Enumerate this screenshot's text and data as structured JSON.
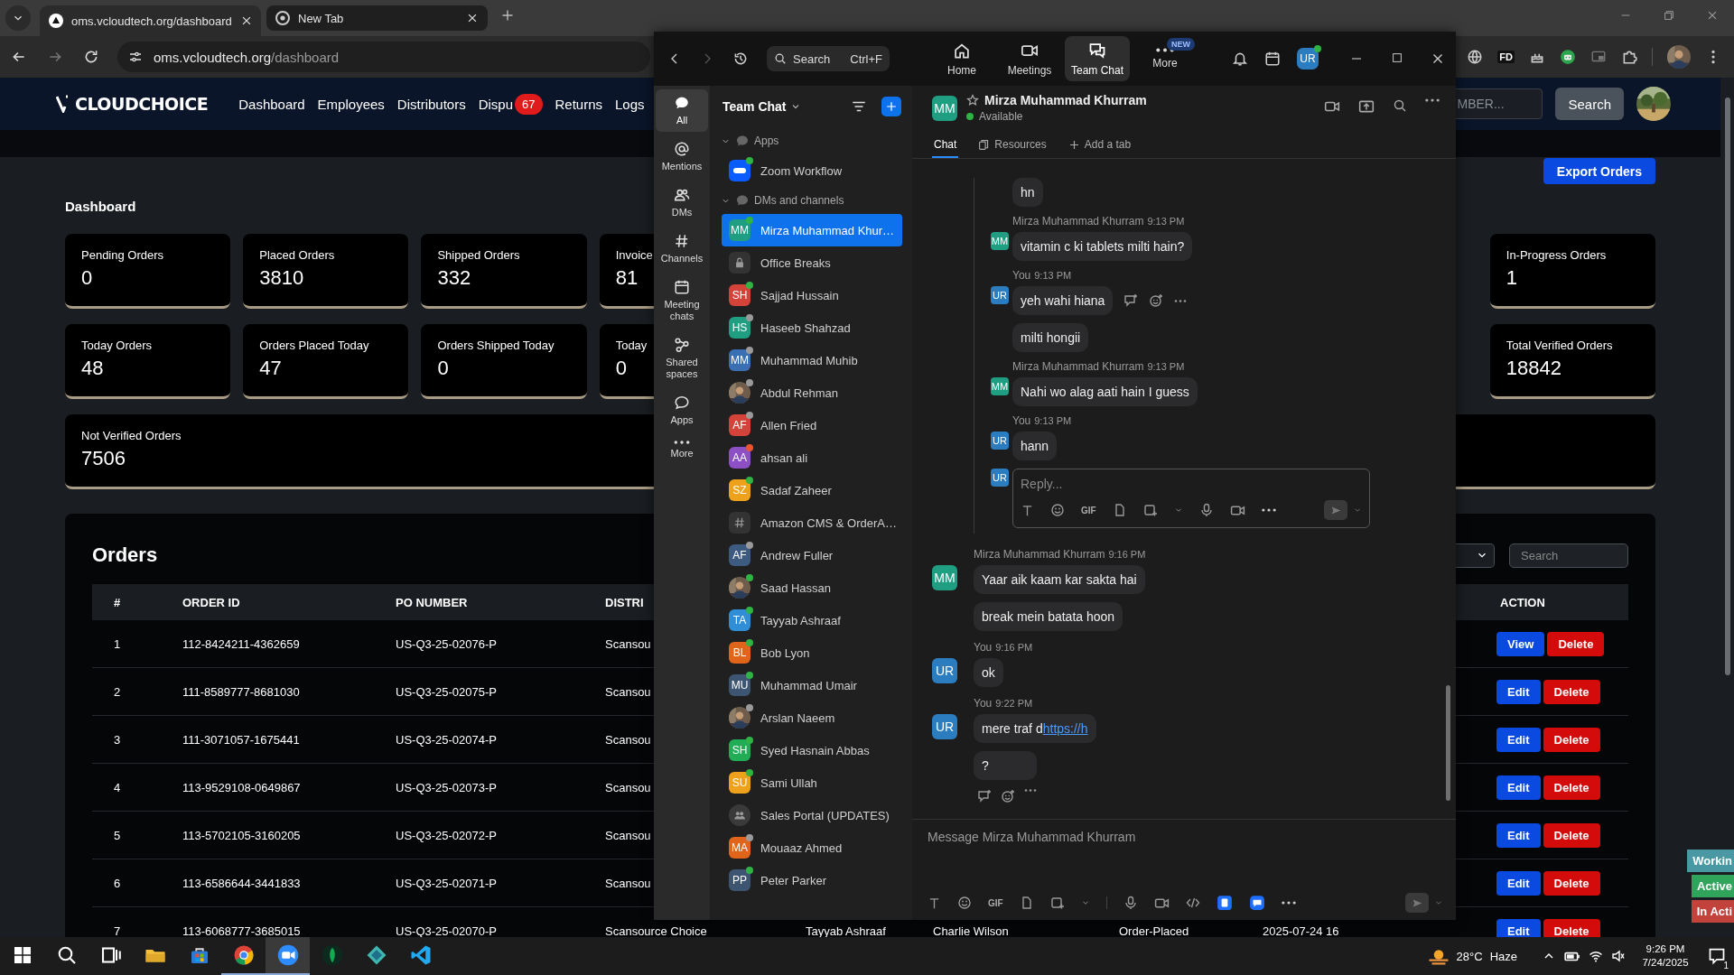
{
  "browser": {
    "tabs": [
      {
        "title": "oms.vcloudtech.org/dashboard",
        "selected": true
      },
      {
        "title": "New Tab",
        "selected": false
      }
    ],
    "url": {
      "host": "oms.vcloudtech.org",
      "path": "/dashboard"
    },
    "extension_label": "FD"
  },
  "site": {
    "brand": "CLOUDCHOICE",
    "nav": [
      {
        "label": "Dashboard"
      },
      {
        "label": "Employees"
      },
      {
        "label": "Distributors"
      },
      {
        "label": "Dispu",
        "badge": "67"
      },
      {
        "label": "Returns"
      },
      {
        "label": "Logs"
      }
    ],
    "search": {
      "placeholder": "MBER..."
    },
    "search_button": "Search"
  },
  "dashboard": {
    "export_button": "Export Orders",
    "title": "Dashboard",
    "stat_rows": [
      {
        "left": [
          {
            "label": "Pending Orders",
            "value": "0"
          },
          {
            "label": "Placed Orders",
            "value": "3810"
          },
          {
            "label": "Shipped Orders",
            "value": "332"
          },
          {
            "label": "Invoice",
            "value": "81"
          }
        ],
        "right": {
          "label": "In-Progress Orders",
          "value": "1"
        }
      },
      {
        "left": [
          {
            "label": "Today Orders",
            "value": "48"
          },
          {
            "label": "Orders Placed Today",
            "value": "47"
          },
          {
            "label": "Orders Shipped Today",
            "value": "0"
          },
          {
            "label": "Today",
            "value": "0"
          }
        ],
        "right": {
          "label": "Total Verified Orders",
          "value": "18842"
        }
      }
    ],
    "wide_card": {
      "label": "Not Verified Orders",
      "value": "7506"
    }
  },
  "orders": {
    "title": "Orders",
    "search": {
      "placeholder": "Search"
    },
    "columns": {
      "index": "#",
      "order_id": "ORDER ID",
      "po_number": "PO NUMBER",
      "distributor": "DISTRI",
      "action": "ACTION"
    },
    "rows": [
      {
        "index": "1",
        "order_id": "112-8424211-4362659",
        "po_number": "US-Q3-25-02076-P",
        "distributor": "Scansou",
        "actions": [
          {
            "label": "View",
            "kind": "view"
          },
          {
            "label": "Delete",
            "kind": "delete"
          }
        ]
      },
      {
        "index": "2",
        "order_id": "111-8589777-8681030",
        "po_number": "US-Q3-25-02075-P",
        "distributor": "Scansou",
        "actions": [
          {
            "label": "Edit",
            "kind": "edit"
          },
          {
            "label": "Delete",
            "kind": "delete"
          }
        ]
      },
      {
        "index": "3",
        "order_id": "111-3071057-1675441",
        "po_number": "US-Q3-25-02074-P",
        "distributor": "Scansou",
        "actions": [
          {
            "label": "Edit",
            "kind": "edit"
          },
          {
            "label": "Delete",
            "kind": "delete"
          }
        ]
      },
      {
        "index": "4",
        "order_id": "113-9529108-0649867",
        "po_number": "US-Q3-25-02073-P",
        "distributor": "Scansou",
        "actions": [
          {
            "label": "Edit",
            "kind": "edit"
          },
          {
            "label": "Delete",
            "kind": "delete"
          }
        ]
      },
      {
        "index": "5",
        "order_id": "113-5702105-3160205",
        "po_number": "US-Q3-25-02072-P",
        "distributor": "Scansou",
        "actions": [
          {
            "label": "Edit",
            "kind": "edit"
          },
          {
            "label": "Delete",
            "kind": "delete"
          }
        ]
      },
      {
        "index": "6",
        "order_id": "113-6586644-3441833",
        "po_number": "US-Q3-25-02071-P",
        "distributor": "Scansou",
        "actions": [
          {
            "label": "Edit",
            "kind": "edit"
          },
          {
            "label": "Delete",
            "kind": "delete"
          }
        ]
      },
      {
        "index": "7",
        "order_id": "113-6068777-3685015",
        "po_number": "US-Q3-25-02070-P",
        "distributor": "Scansource Choice",
        "column_5": "Tayyab Ashraaf",
        "column_6": "Charlie Wilson",
        "column_7": "Order-Placed",
        "column_8": "2025-07-24 16",
        "actions": [
          {
            "label": "Edit",
            "kind": "edit"
          },
          {
            "label": "Delete",
            "kind": "delete"
          }
        ]
      }
    ]
  },
  "status_tags": [
    {
      "label": "Workin",
      "color": "#4a98a3"
    },
    {
      "label": "Active",
      "color": "#2fa45a"
    },
    {
      "label": "In Acti",
      "color": "#c2433b"
    }
  ],
  "zoom": {
    "search": {
      "placeholder": "Search",
      "shortcut": "Ctrl+F"
    },
    "nav": [
      {
        "label": "Home",
        "selected": false
      },
      {
        "label": "Meetings",
        "selected": false
      },
      {
        "label": "Team Chat",
        "selected": true
      },
      {
        "label": "More",
        "selected": false,
        "badge": "NEW"
      }
    ],
    "user": {
      "initials": "UR",
      "color": "#2c7cc0",
      "status": {
        "color": "#2fb344"
      }
    },
    "rail": [
      {
        "label": "All",
        "selected": true
      },
      {
        "label": "Mentions",
        "selected": false
      },
      {
        "label": "DMs",
        "selected": false
      },
      {
        "label": "Channels",
        "selected": false
      },
      {
        "label": "Meeting chats",
        "selected": false
      },
      {
        "label": "Shared spaces",
        "selected": false
      },
      {
        "label": "Apps",
        "selected": false
      },
      {
        "label": "More",
        "selected": false
      }
    ],
    "list": {
      "title": "Team Chat",
      "sections": [
        {
          "label": "Apps",
          "expanded": true,
          "items": [
            {
              "name": "Zoom Workflow",
              "avatar": {
                "kind": "app"
              },
              "status": {
                "color": "#2fb344"
              },
              "selected": false
            }
          ]
        },
        {
          "label": "DMs and channels",
          "expanded": true,
          "items": [
            {
              "name": "Mirza Muhammad Khur…",
              "avatar": {
                "kind": "initials",
                "initials": "MM",
                "color": "#1f9e82"
              },
              "status": {
                "color": "#2fb344"
              },
              "selected": true
            },
            {
              "name": "Office Breaks",
              "avatar": {
                "kind": "lock"
              },
              "selected": false
            },
            {
              "name": "Sajjad Hussain",
              "avatar": {
                "kind": "initials",
                "initials": "SH",
                "color": "#d4433a"
              },
              "status": {
                "color": "#2fb344"
              },
              "selected": false
            },
            {
              "name": "Haseeb Shahzad",
              "avatar": {
                "kind": "initials",
                "initials": "HS",
                "color": "#1f9e82"
              },
              "status": {
                "color": "#9a9a9a"
              },
              "selected": false
            },
            {
              "name": "Muhammad Muhib",
              "avatar": {
                "kind": "initials",
                "initials": "MM",
                "color": "#3b6fb3"
              },
              "status": {
                "color": "#9a9a9a"
              },
              "selected": false
            },
            {
              "name": "Abdul Rehman",
              "status": {
                "color": "#9a9a9a"
              },
              "selected": false
            },
            {
              "name": "Allen Fried",
              "avatar": {
                "kind": "initials",
                "initials": "AF",
                "color": "#d4433a"
              },
              "status": {
                "color": "#9a9a9a"
              },
              "selected": false
            },
            {
              "name": "ahsan ali",
              "avatar": {
                "kind": "initials",
                "initials": "AA",
                "color": "#8d4fc4"
              },
              "status": {
                "color": "#e9542f"
              },
              "selected": false
            },
            {
              "name": "Sadaf Zaheer",
              "avatar": {
                "kind": "initials",
                "initials": "SZ",
                "color": "#eea11b"
              },
              "status": {
                "color": "#2fb344"
              },
              "selected": false
            },
            {
              "name": "Amazon CMS & OrderA…",
              "avatar": {
                "kind": "hash"
              },
              "selected": false
            },
            {
              "name": "Andrew Fuller",
              "avatar": {
                "kind": "initials",
                "initials": "AF",
                "color": "#3d5a80"
              },
              "status": {
                "color": "#9a9a9a"
              },
              "selected": false
            },
            {
              "name": "Saad Hassan",
              "status": {
                "color": "#2fb344"
              },
              "selected": false
            },
            {
              "name": "Tayyab Ashraaf",
              "avatar": {
                "kind": "initials",
                "initials": "TA",
                "color": "#2f8ed6"
              },
              "status": {
                "color": "#2fb344"
              },
              "selected": false
            },
            {
              "name": "Bob Lyon",
              "avatar": {
                "kind": "initials",
                "initials": "BL",
                "color": "#e0651b"
              },
              "status": {
                "color": "#2fb344"
              },
              "selected": false
            },
            {
              "name": "Muhammad Umair",
              "avatar": {
                "kind": "initials",
                "initials": "MU",
                "color": "#3d5570"
              },
              "status": {
                "color": "#2fb344"
              },
              "selected": false
            },
            {
              "name": "Arslan Naeem",
              "status": {
                "color": "#9a9a9a"
              },
              "selected": false
            },
            {
              "name": "Syed Hasnain Abbas",
              "avatar": {
                "kind": "initials",
                "initials": "SH",
                "color": "#21ad56"
              },
              "status": {
                "color": "#2fb344"
              },
              "selected": false
            },
            {
              "name": "Sami Ullah",
              "avatar": {
                "kind": "initials",
                "initials": "SU",
                "color": "#eea11b"
              },
              "status": {
                "color": "#2fb344"
              },
              "selected": false
            },
            {
              "name": "Sales Portal (UPDATES)",
              "avatar": {
                "kind": "group"
              },
              "selected": false
            },
            {
              "name": "Mouaaz Ahmed",
              "avatar": {
                "kind": "initials",
                "initials": "MA",
                "color": "#e0651b"
              },
              "status": {
                "color": "#9a9a9a"
              },
              "selected": false
            },
            {
              "name": "Peter Parker",
              "avatar": {
                "kind": "initials",
                "initials": "PP",
                "color": "#3d5570"
              },
              "status": {
                "color": "#2fb344"
              },
              "selected": false
            }
          ]
        }
      ]
    },
    "chat": {
      "contact": "Mirza Muhammad Khurram",
      "initials": "MM",
      "color": "#1f9e82",
      "status": "Available",
      "tabs": [
        {
          "label": "Chat",
          "kind": "chat",
          "selected": true
        },
        {
          "label": "Resources",
          "kind": "resources",
          "selected": false
        },
        {
          "label": "Add a tab",
          "kind": "add",
          "selected": false
        }
      ],
      "thread": {
        "messages": [
          {
            "bubbles": [
              {
                "text": "hn"
              }
            ]
          },
          {
            "sender": "Mirza Muhammad Khurram",
            "time": "9:13 PM",
            "initials": "MM",
            "color": "#1f9e82",
            "bubbles": [
              {
                "text": "vitamin c ki tablets milti hain?"
              }
            ]
          },
          {
            "sender": "You",
            "time": "9:13 PM",
            "initials": "UR",
            "color": "#2c7cc0",
            "bubbles": [
              {
                "text": "yeh wahi hiana",
                "hovered": true
              },
              {
                "text": "milti hongii"
              }
            ]
          },
          {
            "sender": "Mirza Muhammad Khurram",
            "time": "9:13 PM",
            "initials": "MM",
            "color": "#1f9e82",
            "bubbles": [
              {
                "text": "Nahi wo alag aati hain I guess"
              }
            ]
          },
          {
            "sender": "You",
            "time": "9:13 PM",
            "initials": "UR",
            "color": "#2c7cc0",
            "bubbles": [
              {
                "text": "hann"
              }
            ]
          }
        ],
        "reply_initials": "UR",
        "reply_placeholder": "Reply...",
        "gif_label": "GIF"
      },
      "messages": [
        {
          "sender": "Mirza Muhammad Khurram",
          "time": "9:16 PM",
          "initials": "MM",
          "color": "#1f9e82",
          "bubbles": [
            {
              "text": "Yaar aik kaam kar sakta hai"
            },
            {
              "text": "break mein batata hoon"
            }
          ]
        },
        {
          "sender": "You",
          "time": "9:16 PM",
          "initials": "UR",
          "color": "#2c7cc0",
          "bubbles": [
            {
              "text": "ok"
            }
          ]
        },
        {
          "sender": "You",
          "time": "9:22 PM",
          "initials": "UR",
          "color": "#2c7cc0",
          "bubbles": [
            {
              "text": "mere traf d",
              "link": "https://h"
            },
            {
              "text": "?"
            }
          ],
          "hovered": true
        }
      ],
      "composer": {
        "placeholder": "Message Mirza Muhammad Khurram",
        "gif_label": "GIF"
      }
    }
  },
  "taskbar": {
    "apps": [
      {
        "kind": "start",
        "running": false,
        "focused": false
      },
      {
        "kind": "search",
        "running": false,
        "focused": false
      },
      {
        "kind": "taskview",
        "running": false,
        "focused": false
      },
      {
        "kind": "explorer",
        "running": false,
        "focused": false
      },
      {
        "kind": "store",
        "running": false,
        "focused": false
      },
      {
        "kind": "chrome",
        "running": true,
        "focused": false
      },
      {
        "kind": "zoom",
        "running": true,
        "focused": true
      },
      {
        "kind": "leaf",
        "running": false,
        "focused": false
      },
      {
        "kind": "diamond",
        "running": false,
        "focused": false
      },
      {
        "kind": "vscode",
        "running": false,
        "focused": false
      }
    ],
    "weather": {
      "temperature": "28°C",
      "condition": "Haze"
    },
    "time": "9:26 PM",
    "date": "7/24/2025",
    "notification_count": "1"
  }
}
